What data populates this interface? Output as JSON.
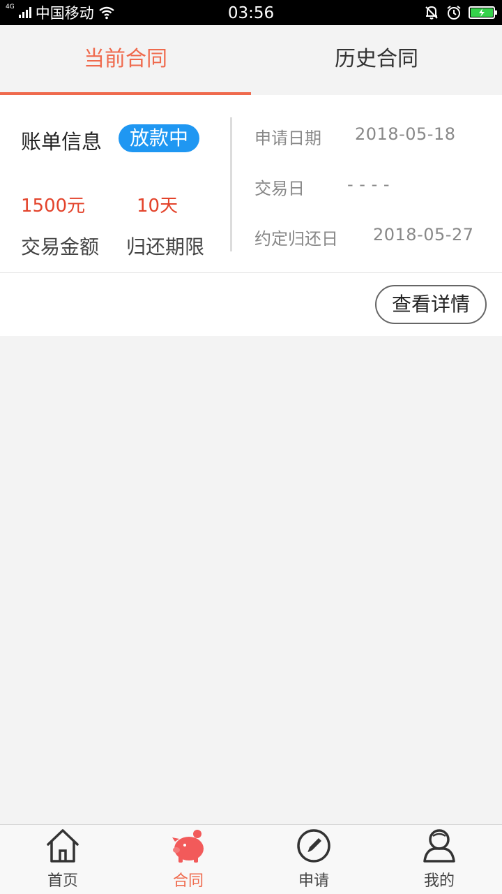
{
  "status_bar": {
    "network": "4G",
    "carrier": "中国移动",
    "time": "03:56",
    "battery_color": "#35d24b"
  },
  "tabs": [
    {
      "label": "当前合同",
      "active": true
    },
    {
      "label": "历史合同",
      "active": false
    }
  ],
  "bill": {
    "title": "账单信息",
    "status": "放款中",
    "amount": "1500元",
    "amount_label": "交易金额",
    "period": "10天",
    "period_label": "归还期限",
    "apply_date_label": "申请日期",
    "apply_date": "2018-05-18",
    "trade_date_label": "交易日",
    "trade_date": "- - - -",
    "due_date_label": "约定归还日",
    "due_date": "2018-05-27",
    "detail_button": "查看详情"
  },
  "bottom_nav": [
    {
      "label": "首页",
      "icon": "home-icon",
      "active": false
    },
    {
      "label": "合同",
      "icon": "piggy-bank-icon",
      "active": true
    },
    {
      "label": "申请",
      "icon": "edit-pen-icon",
      "active": false
    },
    {
      "label": "我的",
      "icon": "user-icon",
      "active": false
    }
  ],
  "colors": {
    "accent": "#ef6a4d",
    "status_pill": "#1f97f2",
    "amount_red": "#e3432b"
  }
}
